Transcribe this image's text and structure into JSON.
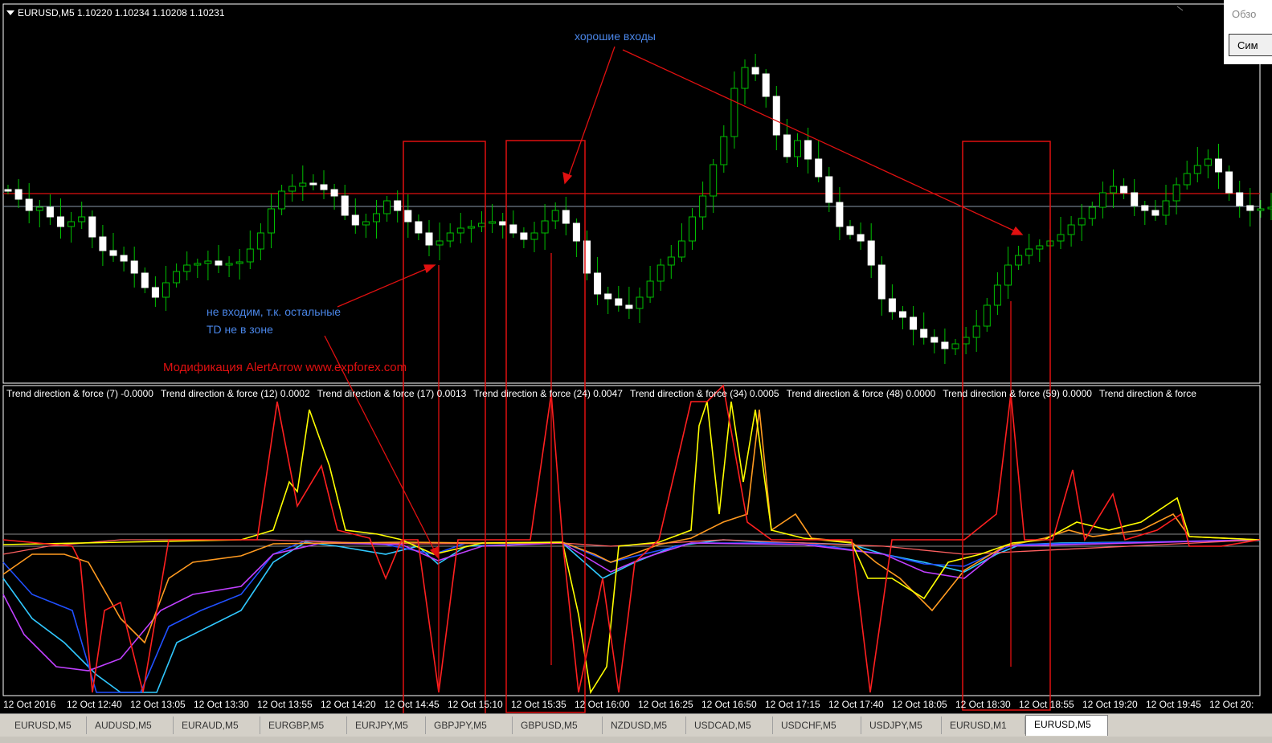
{
  "header": {
    "ohlc": "EURUSD,M5  1.10220 1.10234 1.10208 1.10231"
  },
  "annotations": {
    "good_entries": "хорошие входы",
    "no_entry_line1": "не входим, т.к. остальные",
    "no_entry_line2": "TD не в зоне",
    "modification": "Модификация AlertArrow www.expforex.com"
  },
  "indicator_legend": [
    "Trend direction & force (7) -0.0000",
    "Trend direction & force (12) 0.0002",
    "Trend direction & force (17) 0.0013",
    "Trend direction & force (24) 0.0047",
    "Trend direction & force (34) 0.0005",
    "Trend direction & force (48) 0.0000",
    "Trend direction & force (59) 0.0000",
    "Trend direction & force"
  ],
  "time_axis": [
    "12 Oct 2016",
    "12 Oct 12:40",
    "12 Oct 13:05",
    "12 Oct 13:30",
    "12 Oct 13:55",
    "12 Oct 14:20",
    "12 Oct 14:45",
    "12 Oct 15:10",
    "12 Oct 15:35",
    "12 Oct 16:00",
    "12 Oct 16:25",
    "12 Oct 16:50",
    "12 Oct 17:15",
    "12 Oct 17:40",
    "12 Oct 18:05",
    "12 Oct 18:30",
    "12 Oct 18:55",
    "12 Oct 19:20",
    "12 Oct 19:45",
    "12 Oct 20:"
  ],
  "tabs": [
    "EURUSD,M5",
    "AUDUSD,M5",
    "EURAUD,M5",
    "EURGBP,M5",
    "EURJPY,M5",
    "GBPJPY,M5",
    "GBPUSD,M5",
    "NZDUSD,M5",
    "USDCAD,M5",
    "USDCHF,M5",
    "USDJPY,M5",
    "EURUSD,M1",
    "EURUSD,M5"
  ],
  "active_tab_index": 12,
  "right_panel": {
    "label": "Обзо",
    "button": "Сим"
  },
  "colors": {
    "bull_candle": "#ffffff",
    "bear_candle": "#ffffff",
    "wick": "#00c000",
    "annotation_blue": "#4a86e8",
    "annotation_red": "#e01010",
    "td7": "#ff2020",
    "td12": "#ffff00",
    "td17": "#ff9a20",
    "td24": "#ff6060",
    "td34": "#c040ff",
    "td48": "#2050ff",
    "td59": "#30c8ff"
  }
}
